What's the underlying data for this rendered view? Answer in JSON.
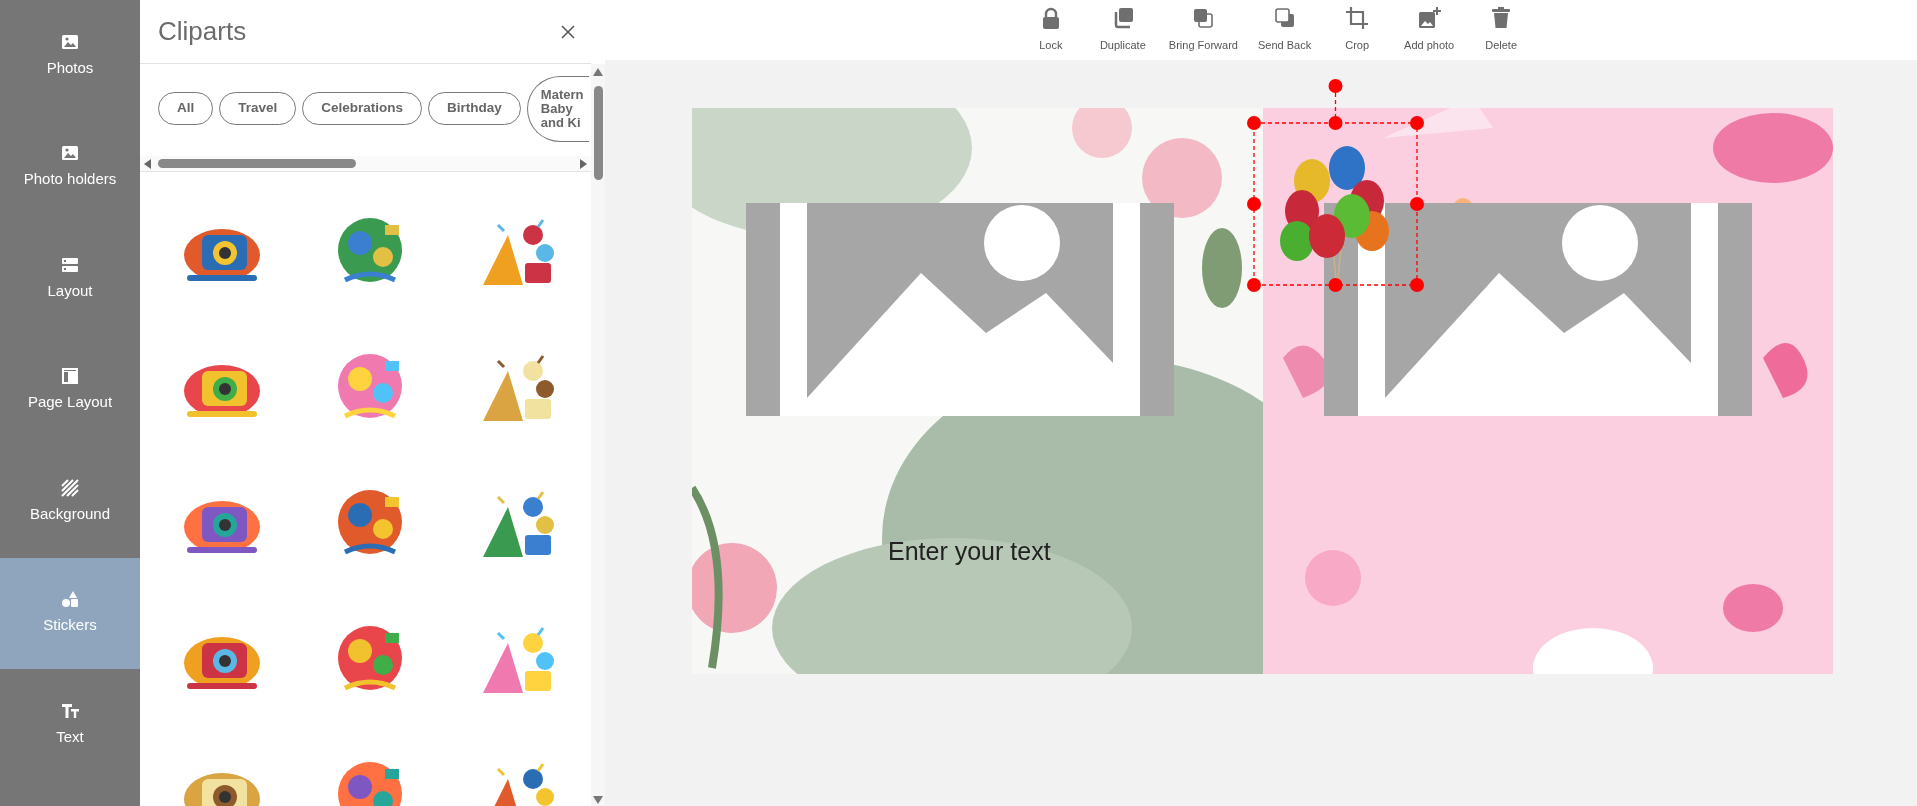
{
  "sidebar": {
    "items": [
      {
        "label": "Photos",
        "selected": false
      },
      {
        "label": "Photo holders",
        "selected": false
      },
      {
        "label": "Layout",
        "selected": false
      },
      {
        "label": "Page Layout",
        "selected": false
      },
      {
        "label": "Background",
        "selected": false
      },
      {
        "label": "Stickers",
        "selected": true
      },
      {
        "label": "Text",
        "selected": false
      }
    ]
  },
  "panel": {
    "title": "Cliparts",
    "chips": [
      {
        "label": "All",
        "selected": false
      },
      {
        "label": "Travel",
        "selected": false
      },
      {
        "label": "Celebrations",
        "selected": false
      },
      {
        "label": "Birthday",
        "selected": false
      },
      {
        "label": "Matern Baby and Ki",
        "selected": false
      }
    ],
    "cliparts": [
      {
        "kind": "picture"
      },
      {
        "kind": "picture"
      },
      {
        "kind": "picture"
      },
      {
        "kind": "picture"
      },
      {
        "kind": "picture"
      },
      {
        "kind": "picture"
      },
      {
        "kind": "picture"
      },
      {
        "kind": "picture"
      },
      {
        "kind": "picture"
      },
      {
        "kind": "picture"
      },
      {
        "kind": "picture"
      },
      {
        "kind": "picture"
      },
      {
        "kind": "picture"
      },
      {
        "kind": "picture"
      },
      {
        "kind": "picture"
      }
    ]
  },
  "toolbar": {
    "buttons": [
      {
        "label": "Lock"
      },
      {
        "label": "Duplicate"
      },
      {
        "label": "Bring Forward"
      },
      {
        "label": "Send Back"
      },
      {
        "label": "Crop"
      },
      {
        "label": "Add photo"
      },
      {
        "label": "Delete"
      }
    ]
  },
  "canvas": {
    "pages": [
      {
        "kind": "picture",
        "photo_filled": false
      },
      {
        "kind": "picture",
        "photo_filled": false
      }
    ],
    "text_box": {
      "text": "Enter your text"
    },
    "sticker": {
      "kind": "picture",
      "selected": true
    }
  }
}
